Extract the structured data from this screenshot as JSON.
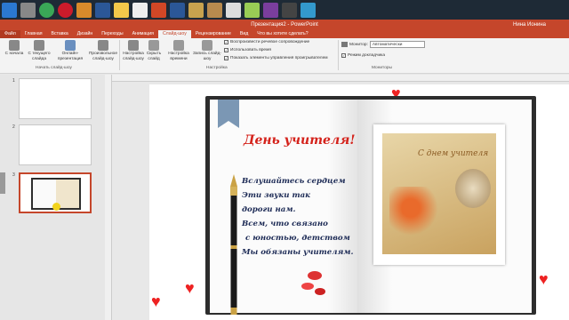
{
  "window": {
    "title": "Презентация2 - PowerPoint",
    "user": "Нина Ионина"
  },
  "tabs": [
    {
      "label": "Файл"
    },
    {
      "label": "Главная"
    },
    {
      "label": "Вставка"
    },
    {
      "label": "Дизайн"
    },
    {
      "label": "Переходы"
    },
    {
      "label": "Анимация"
    },
    {
      "label": "Слайд-шоу"
    },
    {
      "label": "Рецензирование"
    },
    {
      "label": "Вид"
    },
    {
      "label": "Что вы хотите сделать?"
    }
  ],
  "ribbon": {
    "group_start_label": "Начать слайд-шоу",
    "group_setup_label": "Настройка",
    "group_monitors_label": "Мониторы",
    "btn_from_start": "С начала",
    "btn_from_current": "С текущего слайда",
    "btn_online": "Онлайн-презентация",
    "btn_custom": "Произвольное слайд-шоу",
    "btn_setup": "Настройка слайд-шоу",
    "btn_hide": "Скрыть слайд",
    "btn_rehearse": "Настройка времени",
    "btn_record": "Запись слайд-шоу",
    "chk_narration": "Воспроизвести речевое сопровождение",
    "chk_timings": "Использовать время",
    "chk_controls": "Показать элементы управления проигрывателем",
    "monitor_label": "Монитор:",
    "monitor_value": "Автоматически",
    "presenter_view": "Режим докладчика"
  },
  "slides_panel": {
    "numbers": [
      "1",
      "2",
      "3"
    ],
    "selected": 3
  },
  "slide": {
    "heading": "День учителя!",
    "poem": [
      "Вслушайтесь сердцем",
      "Эти звуки так",
      "дороги нам.",
      "Всем, что связано",
      "с юностью, детством",
      "Мы обязаны учителям."
    ],
    "card_text": "С днем учителя"
  },
  "colors": {
    "accent": "#c5462b",
    "heading": "#d4221b",
    "poem": "#1c2a55"
  }
}
